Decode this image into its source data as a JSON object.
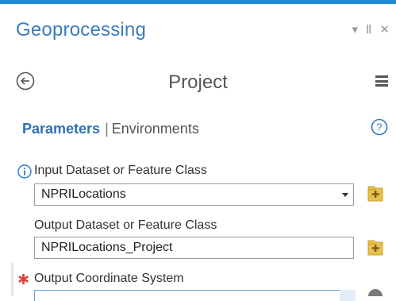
{
  "panel": {
    "title": "Geoprocessing",
    "controls": {
      "dropdown": "▾",
      "pin": "Ⅱ",
      "close": "✕"
    }
  },
  "tool": {
    "title": "Project"
  },
  "tabs": {
    "active": "Parameters",
    "separator": "|",
    "inactive": "Environments"
  },
  "parameters": [
    {
      "label": "Input Dataset or Feature Class",
      "value": "NPRILocations"
    },
    {
      "label": "Output Dataset or Feature Class",
      "value": "NPRILocations_Project"
    },
    {
      "label": "Output Coordinate System",
      "value": ""
    }
  ],
  "colors": {
    "accent": "#1f8dd6",
    "title": "#3a7bbf",
    "required": "#d94848",
    "folder": "#e9c14a"
  }
}
